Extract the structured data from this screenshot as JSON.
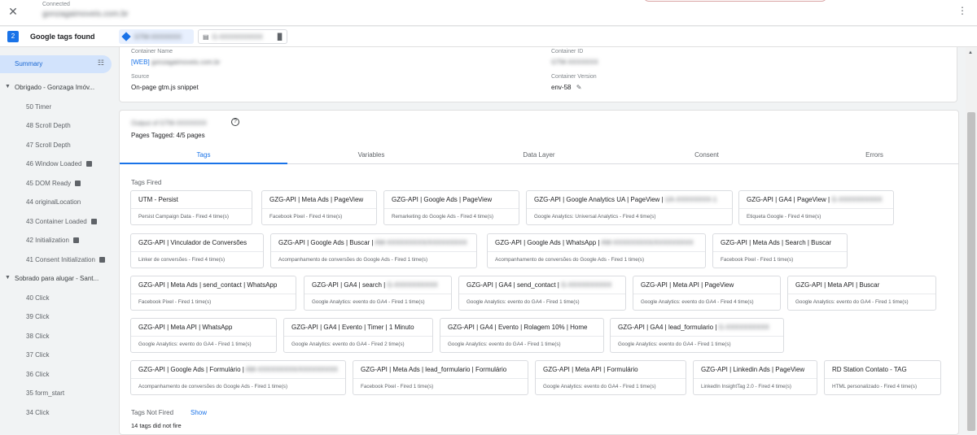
{
  "header": {
    "close_glyph": "✕",
    "status": "Connected",
    "domain": "gonzagaimoveis.com.br",
    "menu_glyph": "⋮"
  },
  "tags_bar": {
    "count": "2",
    "found_label": "Google tags found",
    "chip1_id": "GTM-XXXXXXX",
    "chip2_id": "G-XXXXXXXXXX"
  },
  "sidebar": {
    "summary": "Summary",
    "groups": [
      {
        "label": "Obrigado - Gonzaga Imóv...",
        "items": [
          {
            "label": "50 Timer",
            "icon": false
          },
          {
            "label": "48 Scroll Depth",
            "icon": false
          },
          {
            "label": "47 Scroll Depth",
            "icon": false
          },
          {
            "label": "46 Window Loaded",
            "icon": true
          },
          {
            "label": "45 DOM Ready",
            "icon": true
          },
          {
            "label": "44 originalLocation",
            "icon": false
          },
          {
            "label": "43 Container Loaded",
            "icon": true
          },
          {
            "label": "42 Initialization",
            "icon": true
          },
          {
            "label": "41 Consent Initialization",
            "icon": true
          }
        ]
      },
      {
        "label": "Sobrado para alugar - Sant...",
        "items": [
          {
            "label": "40 Click",
            "icon": false
          },
          {
            "label": "39 Click",
            "icon": false
          },
          {
            "label": "38 Click",
            "icon": false
          },
          {
            "label": "37 Click",
            "icon": false
          },
          {
            "label": "36 Click",
            "icon": false
          },
          {
            "label": "35 form_start",
            "icon": false
          },
          {
            "label": "34 Click",
            "icon": false
          }
        ]
      }
    ]
  },
  "container": {
    "name_label": "Container Name",
    "name_prefix": "[WEB]",
    "name_value": "gonzagaimoveis.com.br",
    "id_label": "Container ID",
    "id_value": "GTM-XXXXXXX",
    "source_label": "Source",
    "source_value": "On-page gtm.js snippet",
    "version_label": "Container Version",
    "version_value": "env-58"
  },
  "main": {
    "title_blur": "Output of GTM-XXXXXXX",
    "help_glyph": "?",
    "pages_tagged": "Pages Tagged: 4/5 pages",
    "tabs": [
      "Tags",
      "Variables",
      "Data Layer",
      "Consent",
      "Errors"
    ],
    "tags_fired_label": "Tags Fired",
    "tags": [
      {
        "name": "UTM - Persist",
        "blur": "",
        "sub": "Persist Campaign Data - Fired 4 time(s)"
      },
      {
        "name": "GZG-API | Meta Ads | PageView",
        "blur": "",
        "sub": "Facebook Pixel - Fired 4 time(s)"
      },
      {
        "name": "GZG-API | Google Ads | PageView",
        "blur": "",
        "sub": "Remarketing do Google Ads - Fired 4 time(s)"
      },
      {
        "name": "GZG-API | Google Analytics UA | PageView |",
        "blur": "UA-XXXXXXXX-1",
        "sub": "Google Analytics: Universal Analytics - Fired 4 time(s)"
      },
      {
        "name": "GZG-API | GA4 | PageView |",
        "blur": "G-XXXXXXXXXX",
        "sub": "Etiqueta Google - Fired 4 time(s)"
      },
      {
        "name": "GZG-API | Vinculador de Conversões",
        "blur": "",
        "sub": "Linker de conversões - Fired 4 time(s)"
      },
      {
        "name": "GZG-API | Google Ads | Buscar |",
        "blur": "AW-XXXXXXXXX/XXXXXXXXX",
        "sub": "Acompanhamento de conversões do Google Ads - Fired 1 time(s)"
      },
      {
        "name": "GZG-API | Google Ads | WhatsApp |",
        "blur": "AW-XXXXXXXXX/XXXXXXXXX",
        "sub": "Acompanhamento de conversões do Google Ads - Fired 1 time(s)"
      },
      {
        "name": "GZG-API | Meta Ads | Search | Buscar",
        "blur": "",
        "sub": "Facebook Pixel - Fired 1 time(s)"
      },
      {
        "name": "GZG-API | Meta Ads | send_contact | WhatsApp",
        "blur": "",
        "sub": "Facebook Pixel - Fired 1 time(s)"
      },
      {
        "name": "GZG-API | GA4 | search |",
        "blur": "G-XXXXXXXXXX",
        "sub": "Google Analytics: evento do GA4 - Fired 1 time(s)"
      },
      {
        "name": "GZG-API | GA4 | send_contact |",
        "blur": "G-XXXXXXXXXX",
        "sub": "Google Analytics: evento do GA4 - Fired 1 time(s)"
      },
      {
        "name": "GZG-API | Meta API | PageView",
        "blur": "",
        "sub": "Google Analytics: evento do GA4 - Fired 4 time(s)"
      },
      {
        "name": "GZG-API | Meta API | Buscar",
        "blur": "",
        "sub": "Google Analytics: evento do GA4 - Fired 1 time(s)"
      },
      {
        "name": "GZG-API | Meta API | WhatsApp",
        "blur": "",
        "sub": "Google Analytics: evento do GA4 - Fired 1 time(s)"
      },
      {
        "name": "GZG-API | GA4 | Evento | Timer | 1 Minuto",
        "blur": "",
        "sub": "Google Analytics: evento do GA4 - Fired 2 time(s)"
      },
      {
        "name": "GZG-API | GA4 | Evento | Rolagem 10% | Home",
        "blur": "",
        "sub": "Google Analytics: evento do GA4 - Fired 1 time(s)"
      },
      {
        "name": "GZG-API | GA4 | lead_formulario |",
        "blur": "G-XXXXXXXXXX",
        "sub": "Google Analytics: evento do GA4 - Fired 1 time(s)"
      },
      {
        "name": "GZG-API | Google Ads | Formulário |",
        "blur": "AW-XXXXXXXXX/XXXXXXXXX",
        "sub": "Acompanhamento de conversões do Google Ads - Fired 1 time(s)"
      },
      {
        "name": "GZG-API | Meta Ads | lead_formulario | Formulário",
        "blur": "",
        "sub": "Facebook Pixel - Fired 1 time(s)"
      },
      {
        "name": "GZG-API | Meta API | Formulário",
        "blur": "",
        "sub": "Google Analytics: evento do GA4 - Fired 1 time(s)"
      },
      {
        "name": "GZG-API | Linkedin Ads | PageView",
        "blur": "",
        "sub": "LinkedIn InsightTag 2.0 - Fired 4 time(s)"
      },
      {
        "name": "RD Station Contato - TAG",
        "blur": "",
        "sub": "HTML personalizado - Fired 4 time(s)"
      }
    ],
    "not_fired_label": "Tags Not Fired",
    "show_label": "Show",
    "not_fired_count": "14 tags did not fire"
  }
}
